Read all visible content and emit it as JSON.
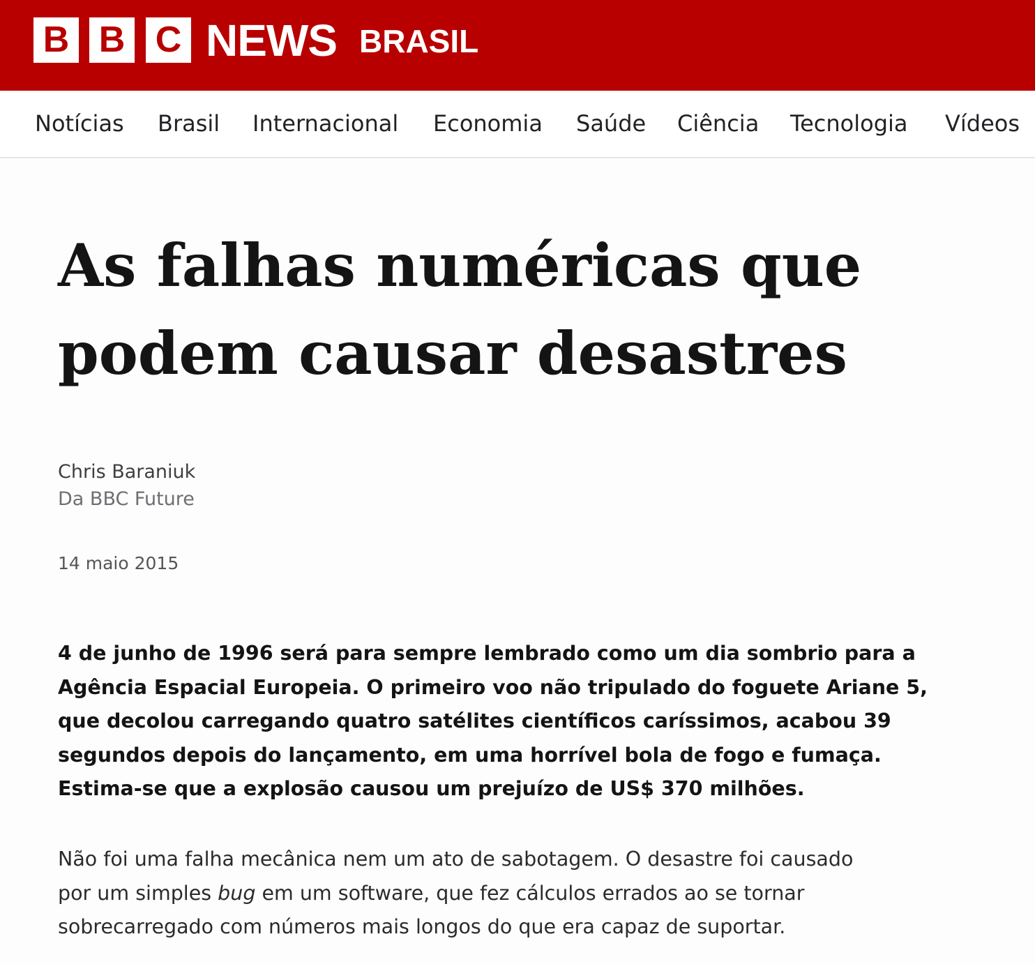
{
  "masthead": {
    "logo_letters": [
      "B",
      "B",
      "C"
    ],
    "brand_name": "NEWS",
    "service_name": "BRASIL",
    "background_color": "#b80000"
  },
  "nav": {
    "items": [
      {
        "label": "Notícias"
      },
      {
        "label": "Brasil"
      },
      {
        "label": "Internacional"
      },
      {
        "label": "Economia"
      },
      {
        "label": "Saúde"
      },
      {
        "label": "Ciência"
      },
      {
        "label": "Tecnologia"
      },
      {
        "label": "Vídeos"
      }
    ]
  },
  "article": {
    "headline_lines": [
      "As falhas numéricas que",
      "podem causar desastres"
    ],
    "author": "Chris Baraniuk",
    "author_role": "Da BBC Future",
    "date": "14 maio 2015",
    "lead_lines": [
      "4 de junho de 1996 será para sempre lembrado como um dia sombrio para a",
      "Agência Espacial Europeia. O primeiro voo não tripulado do foguete Ariane 5,",
      "que decolou carregando quatro satélites científicos caríssimos, acabou 39",
      "segundos depois do lançamento, em uma horrível bola de fogo e fumaça.",
      "Estima-se que a explosão causou um prejuízo de US$ 370 milhões."
    ],
    "body": {
      "line1": "Não foi uma falha mecânica nem um ato de sabotagem. O desastre foi causado",
      "line2_before": "por um simples ",
      "line2_italic": "bug",
      "line2_after": " em um software, que fez cálculos errados ao se tornar",
      "line3": "sobrecarregado com números mais longos do que era capaz de suportar."
    }
  }
}
